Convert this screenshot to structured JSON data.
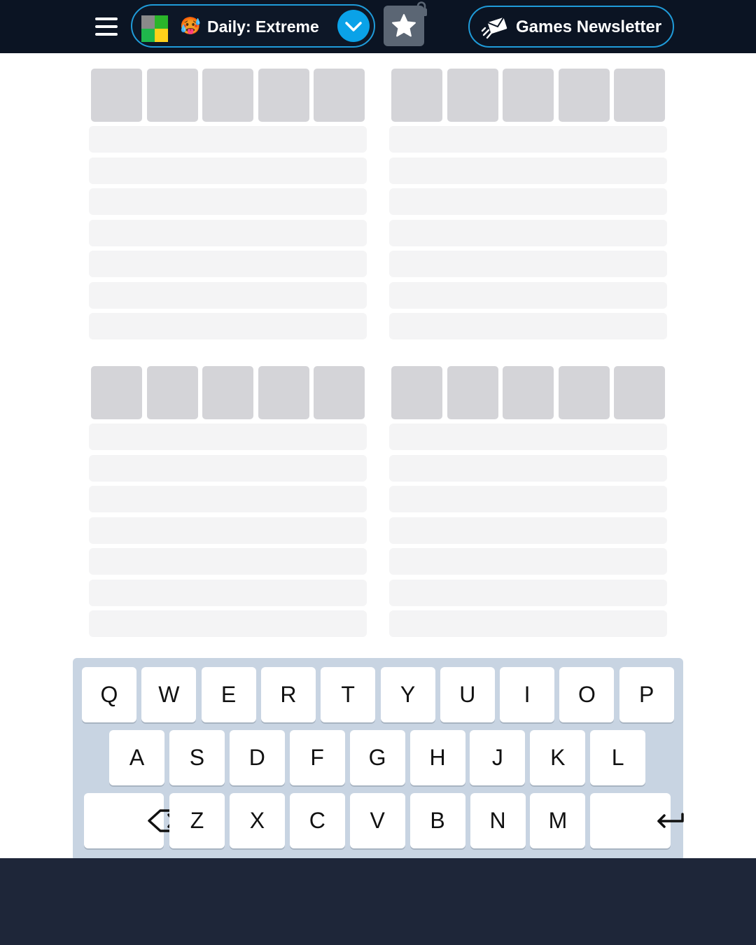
{
  "header": {
    "mode_label": "Daily: Extreme",
    "mode_emoji": "🥵",
    "newsletter_label": "Games Newsletter",
    "icons": {
      "menu": "hamburger-menu-icon",
      "logo": "game-logo-icon",
      "chevron": "chevron-down-icon",
      "favorite": "star-icon",
      "lock": "lock-icon",
      "newsletter": "flying-envelope-icon"
    },
    "colors": {
      "background": "#0b1423",
      "accent": "#1f9bd9",
      "chevron_bg": "#0aa2e8",
      "logo": [
        "#8a8a8a",
        "#2ab52a",
        "#1fb84c",
        "#ffd11a"
      ]
    }
  },
  "boards": {
    "count": 4,
    "tiles_per_board": 5,
    "rows_per_board": 7,
    "tile_color": "#d4d4d8",
    "row_color": "#f4f4f5"
  },
  "keyboard": {
    "row1": [
      "Q",
      "W",
      "E",
      "R",
      "T",
      "Y",
      "U",
      "I",
      "O",
      "P"
    ],
    "row2": [
      "A",
      "S",
      "D",
      "F",
      "G",
      "H",
      "J",
      "K",
      "L"
    ],
    "row3": [
      "Z",
      "X",
      "C",
      "V",
      "B",
      "N",
      "M"
    ],
    "backspace_icon": "backspace-icon",
    "enter_icon": "enter-arrow-icon"
  }
}
